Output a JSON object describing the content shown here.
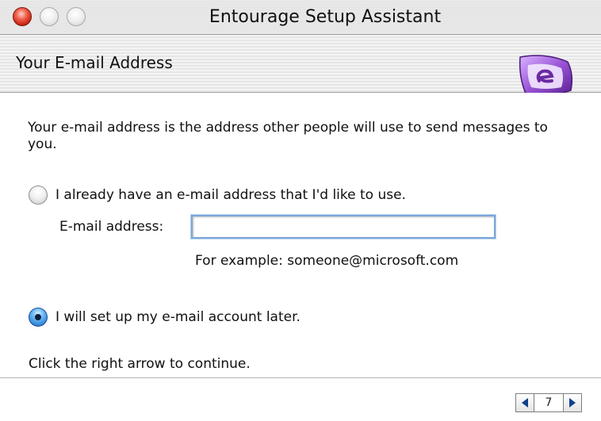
{
  "window": {
    "title": "Entourage Setup Assistant"
  },
  "header": {
    "title": "Your E-mail Address",
    "logo_icon": "entourage-logo-icon"
  },
  "content": {
    "intro": "Your e-mail address is the address other people will use to send messages to you.",
    "option_existing": {
      "label": "I already have an e-mail address that I'd like to use.",
      "selected": false
    },
    "email_field": {
      "label": "E-mail address:",
      "value": "",
      "example": "For example: someone@microsoft.com"
    },
    "option_later": {
      "label": "I will set up my e-mail account later.",
      "selected": true
    },
    "instruction": "Click the right arrow to continue."
  },
  "footer": {
    "page_number": "7",
    "prev_icon": "left-arrow-icon",
    "next_icon": "right-arrow-icon"
  },
  "colors": {
    "radio_selected": "#1566c8",
    "field_focus_ring": "#7aa7d8",
    "logo_purple": "#7b3fb5"
  }
}
